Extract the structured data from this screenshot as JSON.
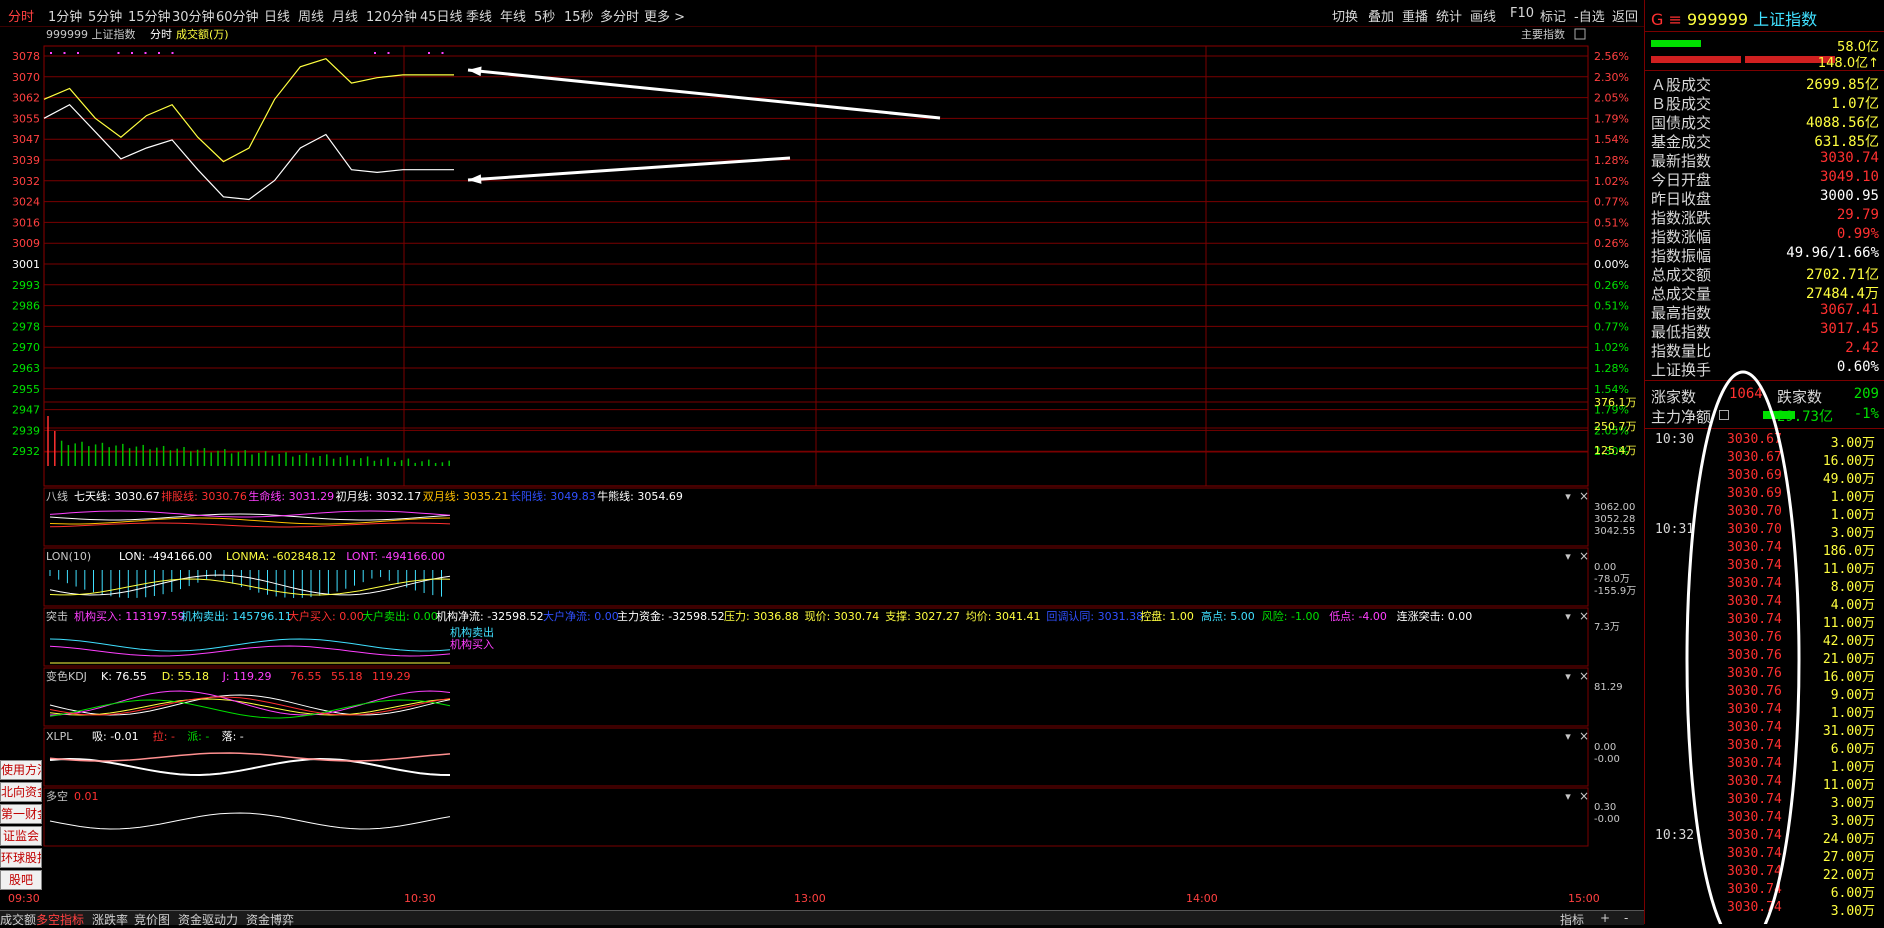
{
  "toolbar": {
    "left": [
      "分时",
      "1分钟",
      "5分钟",
      "15分钟",
      "30分钟",
      "60分钟",
      "日线",
      "周线",
      "月线",
      "120分钟",
      "45日线",
      "季线",
      "年线",
      "5秒",
      "15秒",
      "多分时",
      "更多 >"
    ],
    "right": [
      "切换",
      "叠加",
      "重播",
      "统计",
      "画线",
      "F10",
      "标记",
      "-自选",
      "返回"
    ]
  },
  "chart": {
    "header": {
      "code": "999999",
      "name": "上证指数",
      "mode": "分时",
      "series": "成交额(万)"
    },
    "main_indicator_btn": "主要指数",
    "price_ticks": [
      "3078",
      "3070",
      "3062",
      "3055",
      "3047",
      "3039",
      "3032",
      "3024",
      "3016",
      "3009",
      "3001",
      "2993",
      "2986",
      "2978",
      "2970",
      "2963",
      "2955",
      "2947",
      "2939",
      "2932"
    ],
    "pct_ticks": [
      "2.56%",
      "2.30%",
      "2.05%",
      "1.79%",
      "1.54%",
      "1.28%",
      "1.02%",
      "0.77%",
      "0.51%",
      "0.26%",
      "0.00%",
      "0.26%",
      "0.51%",
      "0.77%",
      "1.02%",
      "1.28%",
      "1.54%",
      "1.79%",
      "2.05%",
      "2.30%"
    ],
    "vol_ticks": [
      "376.1万",
      "250.7万",
      "125.4万"
    ],
    "time_labels": [
      "09:30",
      "10:30",
      "13:00",
      "14:00",
      "15:00"
    ]
  },
  "chart_data": {
    "type": "line",
    "title": "999999 上证指数 分时",
    "x_unit": "time",
    "ylim": [
      2932,
      3078
    ],
    "series": [
      {
        "name": "上证指数",
        "values": [
          3055,
          3060,
          3050,
          3040,
          3044,
          3047,
          3036,
          3026,
          3025,
          3032,
          3044,
          3049,
          3036,
          3035,
          3036,
          3036,
          3036
        ]
      },
      {
        "name": "黄线",
        "values": [
          3062,
          3066,
          3055,
          3048,
          3056,
          3060,
          3048,
          3039,
          3044,
          3062,
          3074,
          3077,
          3068,
          3070,
          3071,
          3071,
          3071
        ]
      }
    ]
  },
  "panels": [
    {
      "name": "八线",
      "items": [
        [
          "七天线: 3030.67",
          "#ffffff"
        ],
        [
          "排股线: 3030.76",
          "#ff3030"
        ],
        [
          "生命线: 3031.29",
          "#ff40ff"
        ],
        [
          "初月线: 3032.17",
          "#ffffff"
        ],
        [
          "双月线: 3035.21",
          "#ffc000"
        ],
        [
          "长阳线: 3049.83",
          "#3050ff"
        ],
        [
          "牛熊线: 3054.69",
          "#ffffff"
        ]
      ],
      "ticks": [
        "3062.00",
        "3052.28",
        "3042.55"
      ]
    },
    {
      "name": "LON(10)",
      "items": [
        [
          "LON: -494166.00",
          "#ffffff"
        ],
        [
          "LONMA: -602848.12",
          "#ffff40"
        ],
        [
          "LONT: -494166.00",
          "#ff40ff"
        ]
      ],
      "ticks": [
        "0.00",
        "-78.0万",
        "-155.9万"
      ]
    },
    {
      "name": "突击",
      "items": [
        [
          "机构买入: 113197.59",
          "#ff40ff"
        ],
        [
          "机构卖出: 145796.11",
          "#40e0ff"
        ],
        [
          "大户买入: 0.00",
          "#ff3030"
        ],
        [
          "大户卖出: 0.00",
          "#00e000"
        ],
        [
          "机构净流: -32598.52",
          "#ffffff"
        ],
        [
          "大户净流: 0.00",
          "#3050ff"
        ],
        [
          "主力资金: -32598.52",
          "#ffffff"
        ],
        [
          "压力: 3036.88",
          "#ffff40"
        ],
        [
          "现价: 3030.74",
          "#ffff40"
        ],
        [
          "支撑: 3027.27",
          "#ffff40"
        ],
        [
          "均价: 3041.41",
          "#ffff40"
        ],
        [
          "回调认同: 3031.38",
          "#3050ff"
        ],
        [
          "控盘: 1.00",
          "#ffff40"
        ],
        [
          "高点: 5.00",
          "#40e0ff"
        ],
        [
          "风险: -1.00",
          "#00e000"
        ],
        [
          "低点: -4.00",
          "#ff40ff"
        ],
        [
          "连涨突击: 0.00",
          "#ffffff"
        ]
      ],
      "ticks": [
        "7.3万"
      ],
      "legend": [
        "机构卖出",
        "机构买入"
      ]
    },
    {
      "name": "变色KDJ",
      "items": [
        [
          "K: 76.55",
          "#ffffff"
        ],
        [
          "D: 55.18",
          "#ffff40"
        ],
        [
          "J: 119.29",
          "#ff40ff"
        ],
        [
          "76.55",
          "#ff3030"
        ],
        [
          "55.18",
          "#ff3030"
        ],
        [
          "119.29",
          "#ff3030"
        ]
      ],
      "ticks": [
        "81.29"
      ]
    },
    {
      "name": "XLPL",
      "items": [
        [
          "吸: -0.01",
          "#ffffff"
        ],
        [
          "拉: -",
          "#ff3030"
        ],
        [
          "派: -",
          "#00e000"
        ],
        [
          "落: -",
          "#ffffff"
        ]
      ],
      "ticks": [
        "0.00",
        "-0.00"
      ]
    },
    {
      "name": "多空",
      "items": [
        [
          "0.01",
          "#ff3030"
        ]
      ],
      "ticks": [
        "0.30",
        "-0.00"
      ]
    }
  ],
  "sidebar_buttons": [
    "使用方法",
    "北向资金",
    "第一财金",
    "证监会",
    "环球股指",
    "股吧"
  ],
  "bottom_tabs": [
    "成交额",
    "多空指标",
    "涨跌率",
    "竞价图",
    "资金驱动力",
    "资金博弈"
  ],
  "bottom_right": [
    "指标",
    "+",
    "-"
  ],
  "right_panel": {
    "title_prefix": "G ≡",
    "code": "999999",
    "name": "上证指数",
    "bar_vals": [
      "58.0亿",
      "148.0亿↑"
    ],
    "rows": [
      {
        "label": "Ａ股成交",
        "value": "2699.85亿",
        "color": "y"
      },
      {
        "label": "Ｂ股成交",
        "value": "1.07亿",
        "color": "y"
      },
      {
        "label": "国债成交",
        "value": "4088.56亿",
        "color": "y"
      },
      {
        "label": "基金成交",
        "value": "631.85亿",
        "color": "y"
      },
      {
        "label": "最新指数",
        "value": "3030.74",
        "color": "r"
      },
      {
        "label": "今日开盘",
        "value": "3049.10",
        "color": "r"
      },
      {
        "label": "昨日收盘",
        "value": "3000.95",
        "color": "w"
      },
      {
        "label": "指数涨跌",
        "value": "29.79",
        "color": "r"
      },
      {
        "label": "指数涨幅",
        "value": "0.99%",
        "color": "r"
      },
      {
        "label": "指数振幅",
        "value": "49.96/1.66%",
        "color": "w"
      },
      {
        "label": "总成交额",
        "value": "2702.71亿",
        "color": "y"
      },
      {
        "label": "总成交量",
        "value": "27484.4万",
        "color": "y"
      },
      {
        "label": "最高指数",
        "value": "3067.41",
        "color": "r"
      },
      {
        "label": "最低指数",
        "value": "3017.45",
        "color": "r"
      },
      {
        "label": "指数量比",
        "value": "2.42",
        "color": "r"
      },
      {
        "label": "上证换手",
        "value": "0.60%",
        "color": "w"
      }
    ],
    "updown": {
      "up_label": "涨家数",
      "up_value": "1064",
      "down_label": "跌家数",
      "down_value": "209"
    },
    "flow": {
      "label": "主力净额",
      "value": "29.73亿",
      "pct": "-1%"
    },
    "ticks": [
      {
        "t": "10:30",
        "p": "3030.67",
        "v": "3.00万"
      },
      {
        "t": "",
        "p": "3030.67",
        "v": "16.00万"
      },
      {
        "t": "",
        "p": "3030.69",
        "v": "49.00万"
      },
      {
        "t": "",
        "p": "3030.69",
        "v": "1.00万"
      },
      {
        "t": "",
        "p": "3030.70",
        "v": "1.00万"
      },
      {
        "t": "10:31",
        "p": "3030.70",
        "v": "3.00万"
      },
      {
        "t": "",
        "p": "3030.74",
        "v": "186.0万"
      },
      {
        "t": "",
        "p": "3030.74",
        "v": "11.00万"
      },
      {
        "t": "",
        "p": "3030.74",
        "v": "8.00万"
      },
      {
        "t": "",
        "p": "3030.74",
        "v": "4.00万"
      },
      {
        "t": "",
        "p": "3030.74",
        "v": "11.00万"
      },
      {
        "t": "",
        "p": "3030.76",
        "v": "42.00万"
      },
      {
        "t": "",
        "p": "3030.76",
        "v": "21.00万"
      },
      {
        "t": "",
        "p": "3030.76",
        "v": "16.00万"
      },
      {
        "t": "",
        "p": "3030.76",
        "v": "9.00万"
      },
      {
        "t": "",
        "p": "3030.74",
        "v": "1.00万"
      },
      {
        "t": "",
        "p": "3030.74",
        "v": "31.00万"
      },
      {
        "t": "",
        "p": "3030.74",
        "v": "6.00万"
      },
      {
        "t": "",
        "p": "3030.74",
        "v": "1.00万"
      },
      {
        "t": "",
        "p": "3030.74",
        "v": "11.00万"
      },
      {
        "t": "",
        "p": "3030.74",
        "v": "3.00万"
      },
      {
        "t": "",
        "p": "3030.74",
        "v": "3.00万"
      },
      {
        "t": "10:32",
        "p": "3030.74",
        "v": "24.00万"
      },
      {
        "t": "",
        "p": "3030.74",
        "v": "27.00万"
      },
      {
        "t": "",
        "p": "3030.74",
        "v": "22.00万"
      },
      {
        "t": "",
        "p": "3030.74",
        "v": "6.00万"
      },
      {
        "t": "",
        "p": "3030.74",
        "v": "3.00万"
      }
    ]
  }
}
